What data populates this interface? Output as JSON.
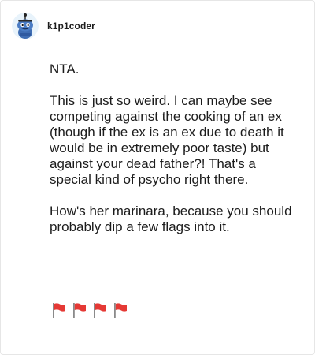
{
  "comment": {
    "username": "k1p1coder",
    "paragraphs": [
      "NTA.",
      "This is just so weird. I can maybe see competing against the cooking of an ex (though if the ex is an ex due to death it would be in extremely poor taste) but against your dead father?! That's a special kind of psycho right there.",
      "How's her marinara, because you should probably dip a few flags into it."
    ],
    "flag_icon": "red-flag-emoji",
    "flag_color": "#e53935",
    "flag_count": 4
  }
}
